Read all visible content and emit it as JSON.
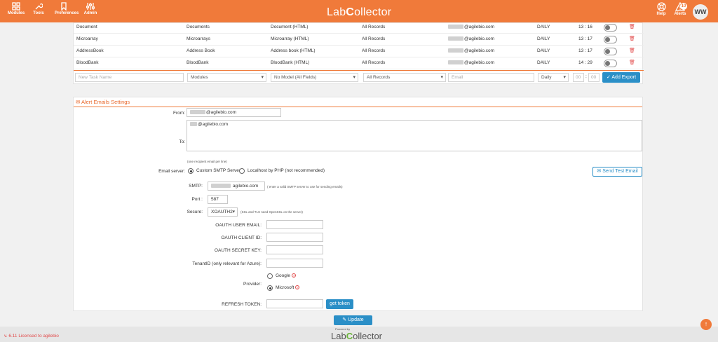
{
  "topbar": {
    "nav": [
      {
        "label": "Modules",
        "icon": "grid-icon"
      },
      {
        "label": "Tools",
        "icon": "wrench-icon"
      },
      {
        "label": "Preferences",
        "icon": "bookmark-icon"
      },
      {
        "label": "Admin",
        "icon": "sliders-icon"
      }
    ],
    "brand_prefix": "Lab",
    "brand_c": "C",
    "brand_suffix": "ollector",
    "help_label": "Help",
    "alerts_label": "Alerts",
    "alerts_count": "10",
    "avatar_initials": "WW"
  },
  "exports": {
    "rows": [
      {
        "name": "Document",
        "module": "Documents",
        "model": "Document (HTML)",
        "records": "All Records",
        "email": "@agilebio.com",
        "freq": "DAILY",
        "time": "13 : 16"
      },
      {
        "name": "Microarray",
        "module": "Microarrays",
        "model": "Microarray (HTML)",
        "records": "All Records",
        "email": "@agilebio.com",
        "freq": "DAILY",
        "time": "13 : 17"
      },
      {
        "name": "AddressBook",
        "module": "Address Book",
        "model": "Address book (HTML)",
        "records": "All Records",
        "email": "@agilebio.com",
        "freq": "DAILY",
        "time": "13 : 17"
      },
      {
        "name": "BloodBank",
        "module": "BloodBank",
        "model": "BloodBank (HTML)",
        "records": "All Records",
        "email": "@agilebio.com",
        "freq": "DAILY",
        "time": "14 : 29"
      }
    ],
    "new_task_placeholder": "New Task Name",
    "modules_select": "Modules",
    "model_select": "No Model (All Fields)",
    "records_select": "All Records",
    "email_placeholder": "Email",
    "freq_select": "Daily",
    "hour_placeholder": "00",
    "minute_placeholder": "00",
    "time_sep": ":",
    "add_export_label": "Add Export"
  },
  "alerts": {
    "title": "Alert Emails Settings",
    "from_label": "From:",
    "from_value": "@agilebio.com",
    "to_label": "To:",
    "to_value": "@agilebio.com",
    "to_note": "(one recipient email per line)",
    "email_server_label": "Email server:",
    "server_option_1": "Custom SMTP Server",
    "server_option_2": "Localhost by PHP (not recommended)",
    "send_test_label": "Send Test Email",
    "smtp_label": "SMTP:",
    "smtp_value": "agilebio.com",
    "smtp_note": "( enter a valid SMTP server to use for sending emails)",
    "port_label": "Port :",
    "port_value": "587",
    "secure_label": "Secure:",
    "secure_value": "XOAUTH2",
    "secure_note": "(SSL and TLS need OpenSSL on the server)",
    "oauth_email_label": "OAUTH USER EMAIL:",
    "oauth_client_label": "OAUTH CLIENT ID:",
    "oauth_secret_label": "OAUTH SECRET KEY:",
    "tenant_label": "TenantID (only relevant for Azure):",
    "provider_label": "Provider:",
    "provider_google": "Google",
    "provider_microsoft": "Microsoft",
    "refresh_label": "REFRESH TOKEN:",
    "get_token_label": "get token",
    "update_label": "Update"
  },
  "footer": {
    "license": "v. 6.11 Licensed to agilebio",
    "powered": "Powered by",
    "logo_prefix": "Lab",
    "logo_c": "C",
    "logo_suffix": "ollector"
  }
}
